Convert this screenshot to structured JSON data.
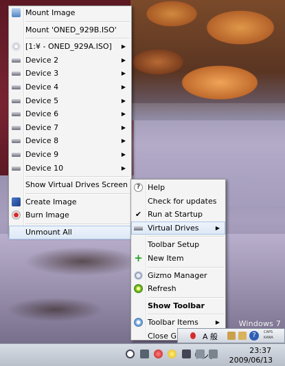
{
  "desktop": {
    "watermark": "Windows 7"
  },
  "main_menu": {
    "items": [
      {
        "label": "Mount Image",
        "icon": "mount-icon",
        "arrow": ""
      },
      {
        "label": "Mount 'ONED_929B.ISO'",
        "icon": "",
        "arrow": ""
      },
      {
        "label": "[1:¥ - ONED_929A.ISO]",
        "icon": "disc-icon",
        "arrow": "▶"
      },
      {
        "label": "Device 2",
        "icon": "drive-icon",
        "arrow": "▶"
      },
      {
        "label": "Device 3",
        "icon": "drive-icon",
        "arrow": "▶"
      },
      {
        "label": "Device 4",
        "icon": "drive-icon",
        "arrow": "▶"
      },
      {
        "label": "Device 5",
        "icon": "drive-icon",
        "arrow": "▶"
      },
      {
        "label": "Device 6",
        "icon": "drive-icon",
        "arrow": "▶"
      },
      {
        "label": "Device 7",
        "icon": "drive-icon",
        "arrow": "▶"
      },
      {
        "label": "Device 8",
        "icon": "drive-icon",
        "arrow": "▶"
      },
      {
        "label": "Device 9",
        "icon": "drive-icon",
        "arrow": "▶"
      },
      {
        "label": "Device 10",
        "icon": "drive-icon",
        "arrow": "▶"
      }
    ],
    "show_vd_screen": "Show Virtual Drives Screen",
    "create_image": "Create Image",
    "burn_image": "Burn Image",
    "unmount_all": "Unmount All"
  },
  "sub_menu": {
    "help": "Help",
    "check_updates": "Check for updates",
    "run_at_startup": "Run at Startup",
    "virtual_drives": "Virtual Drives",
    "toolbar_setup": "Toolbar Setup",
    "new_item": "New Item",
    "gizmo_manager": "Gizmo Manager",
    "refresh": "Refresh",
    "show_toolbar": "Show Toolbar",
    "toolbar_items": "Toolbar Items",
    "close_gizmo": "Close Gizm",
    "arrow": "▶",
    "check": "✔",
    "help_glyph": "?",
    "plus_glyph": "+"
  },
  "taskbar": {
    "links_label": "リンク",
    "time": "23:37",
    "date": "2009/06/13"
  },
  "langbar": {
    "ime": "A 般",
    "caps": "CAPS",
    "kana": "KANA",
    "help": "?"
  },
  "colors": {
    "menu_bg": "#f4f4f4",
    "highlight": "#dce8f6",
    "taskbar": "#c8ced7"
  }
}
